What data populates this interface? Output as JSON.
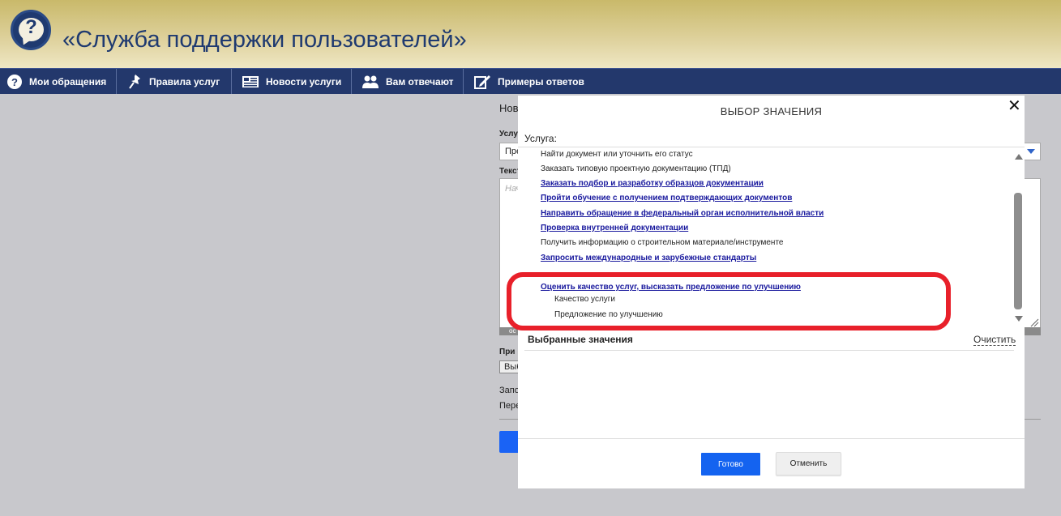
{
  "header": {
    "title": "«Служба поддержки пользователей»",
    "logo_icon": "question-bubble-icon",
    "logo_symbol": "?"
  },
  "nav": {
    "items": [
      {
        "label": "Мои обращения",
        "icon": "question-circle-icon"
      },
      {
        "label": "Правила услуг",
        "icon": "pin-icon"
      },
      {
        "label": "Новости услуги",
        "icon": "newspaper-icon"
      },
      {
        "label": "Вам отвечают",
        "icon": "people-icon"
      },
      {
        "label": "Примеры ответов",
        "icon": "edit-icon"
      }
    ]
  },
  "background_form": {
    "frag_title": "Нов",
    "frag_service": "Услу",
    "frag_service_value": "Пре",
    "frag_text": "Текст",
    "frag_placeholder": "Нач",
    "frag_attach": "При",
    "frag_attach_value": "Выб",
    "frag_note1": "Запо",
    "frag_note2": "Пере",
    "frag_small": "ос"
  },
  "modal": {
    "title": "ВЫБОР ЗНАЧЕНИЯ",
    "close_symbol": "✕",
    "field_label": "Услуга:",
    "items": [
      {
        "label": "Найти документ или уточнить его статус",
        "type": "text"
      },
      {
        "label": "Заказать типовую проектную документацию (ТПД)",
        "type": "text"
      },
      {
        "label": "Заказать подбор и разработку образцов документации",
        "type": "link"
      },
      {
        "label": "Пройти обучение с получением подтверждающих документов",
        "type": "link"
      },
      {
        "label": "Направить обращение в федеральный орган исполнительной власти",
        "type": "link"
      },
      {
        "label": "Проверка внутренней документации",
        "type": "link"
      },
      {
        "label": "Получить информацию о строительном материале/инструменте",
        "type": "text"
      },
      {
        "label": "Запросить международные и зарубежные стандарты",
        "type": "link"
      },
      {
        "label": "Оценить качество услуг, высказать предложение по улучшению",
        "type": "link"
      },
      {
        "label": "Качество услуги",
        "type": "sub"
      },
      {
        "label": "Предложение по улучшению",
        "type": "sub"
      }
    ],
    "selected_title": "Выбранные значения",
    "clear_label": "Очистить",
    "ok_label": "Готово",
    "cancel_label": "Отменить"
  },
  "colors": {
    "nav_bg": "#23386c",
    "title": "#1f3a70",
    "link": "#1a1a9e",
    "primary_button": "#1463f0",
    "highlight": "#e8202a"
  }
}
